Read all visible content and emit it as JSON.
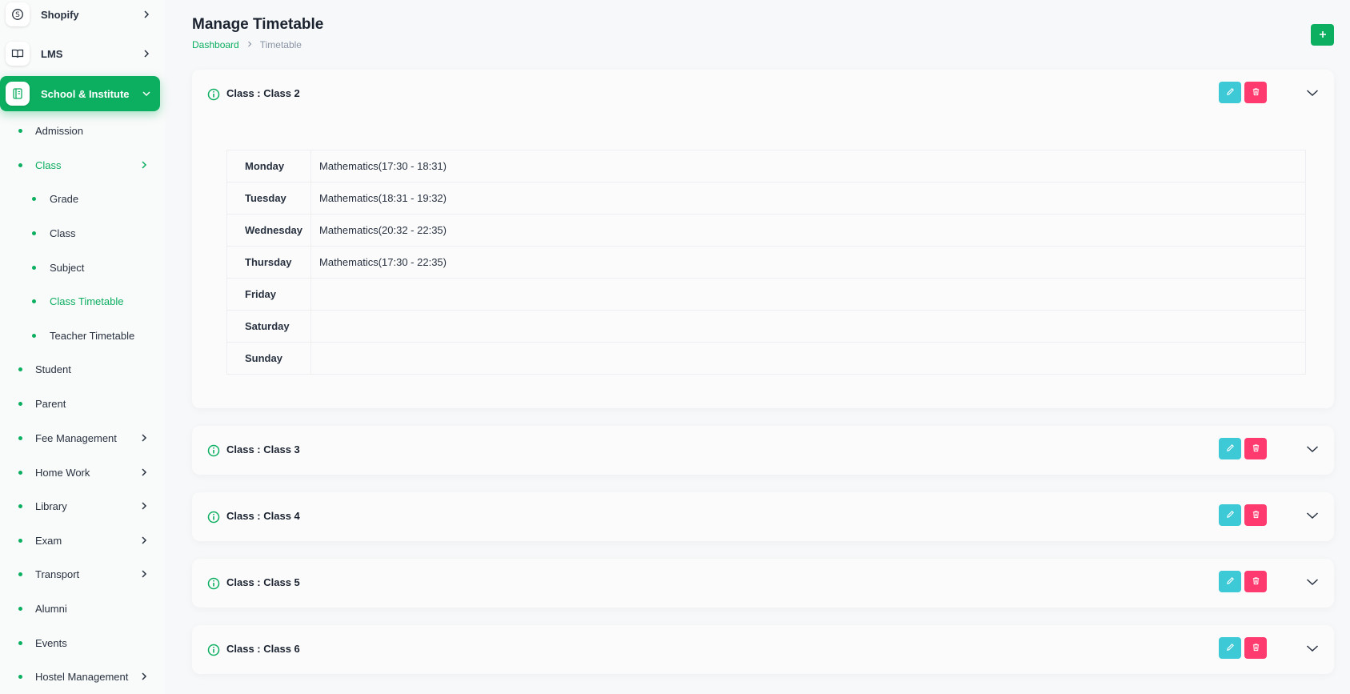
{
  "sidebar": {
    "top_items": [
      {
        "label": "Shopify",
        "icon": "shopify-icon"
      },
      {
        "label": "LMS",
        "icon": "book-icon"
      },
      {
        "label": "School & Institute",
        "icon": "notebook-icon"
      }
    ],
    "sub_items": [
      {
        "label": "Admission"
      },
      {
        "label": "Class"
      },
      {
        "label": "Grade"
      },
      {
        "label": "Class"
      },
      {
        "label": "Subject"
      },
      {
        "label": "Class Timetable"
      },
      {
        "label": "Teacher Timetable"
      },
      {
        "label": "Student"
      },
      {
        "label": "Parent"
      },
      {
        "label": "Fee Management"
      },
      {
        "label": "Home Work"
      },
      {
        "label": "Library"
      },
      {
        "label": "Exam"
      },
      {
        "label": "Transport"
      },
      {
        "label": "Alumni"
      },
      {
        "label": "Events"
      },
      {
        "label": "Hostel Management"
      }
    ]
  },
  "header": {
    "title": "Manage Timetable",
    "breadcrumb": {
      "home": "Dashboard",
      "current": "Timetable"
    }
  },
  "cards": [
    {
      "title": "Class : Class 2",
      "rows": [
        {
          "day": "Monday",
          "value": "Mathematics(17:30 - 18:31)"
        },
        {
          "day": "Tuesday",
          "value": "Mathematics(18:31 - 19:32)"
        },
        {
          "day": "Wednesday",
          "value": "Mathematics(20:32 - 22:35)"
        },
        {
          "day": "Thursday",
          "value": "Mathematics(17:30 - 22:35)"
        },
        {
          "day": "Friday",
          "value": ""
        },
        {
          "day": "Saturday",
          "value": ""
        },
        {
          "day": "Sunday",
          "value": ""
        }
      ]
    },
    {
      "title": "Class : Class 3"
    },
    {
      "title": "Class : Class 4"
    },
    {
      "title": "Class : Class 5"
    },
    {
      "title": "Class : Class 6"
    }
  ],
  "colors": {
    "accent": "#0caf60",
    "edit": "#3ec9d6",
    "delete": "#ff3a6e"
  }
}
